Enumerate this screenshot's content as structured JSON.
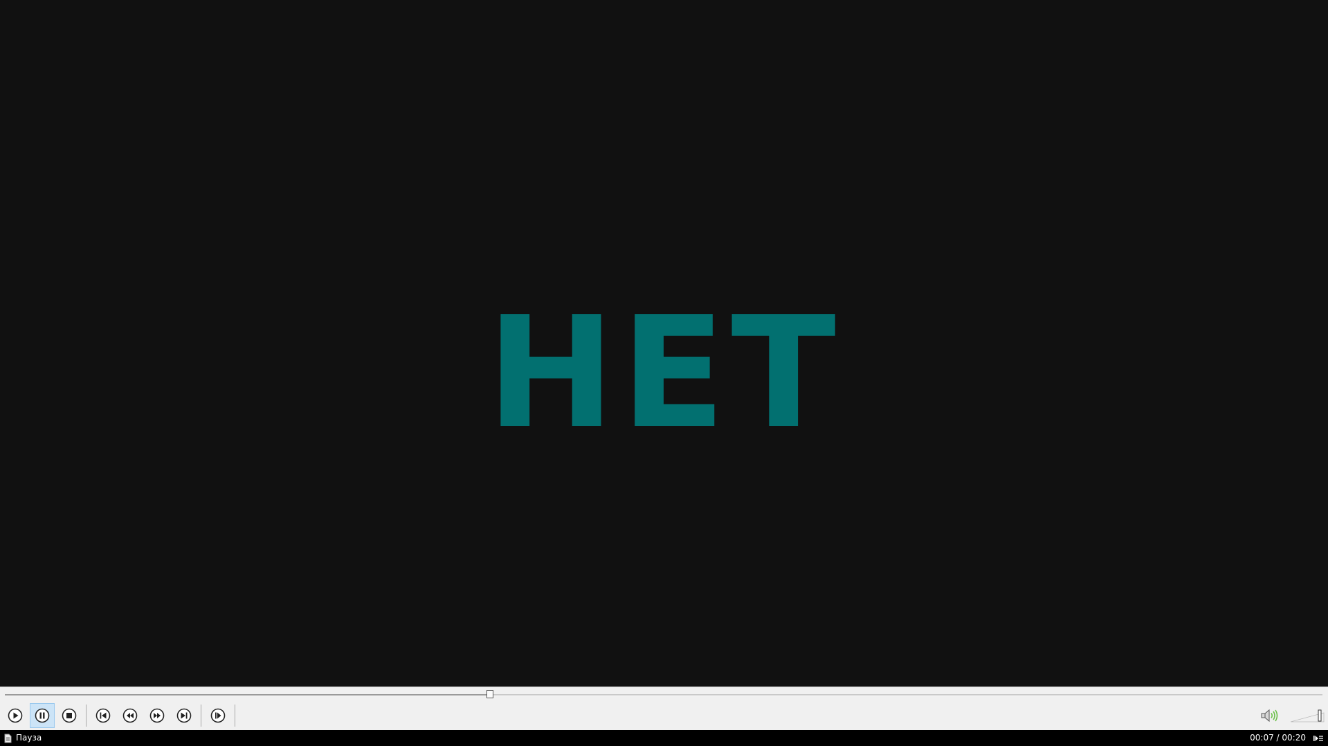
{
  "video": {
    "text": "НЕТ",
    "text_color": "#027070",
    "background": "#111111"
  },
  "playback": {
    "position_fraction": 0.368,
    "volume_fraction": 0.9
  },
  "controls": {
    "buttons": [
      {
        "name": "play-button",
        "icon": "play-icon"
      },
      {
        "name": "pause-button",
        "icon": "pause-icon",
        "active": true
      },
      {
        "name": "stop-button",
        "icon": "stop-icon"
      },
      {
        "name": "previous-button",
        "icon": "previous-icon"
      },
      {
        "name": "rewind-button",
        "icon": "rewind-icon"
      },
      {
        "name": "fast-forward-button",
        "icon": "fast-forward-icon"
      },
      {
        "name": "next-button",
        "icon": "next-icon"
      },
      {
        "name": "step-forward-button",
        "icon": "step-forward-icon"
      }
    ],
    "active_color": "#cce4f7",
    "volume_icon_accent": "#6cc04a"
  },
  "status": {
    "state_label": "Пауза",
    "time": "00:07 / 00:20"
  }
}
